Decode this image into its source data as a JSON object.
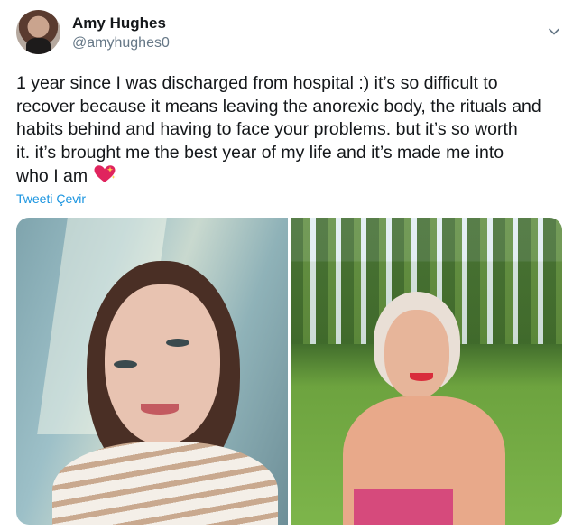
{
  "user": {
    "name": "Amy Hughes",
    "handle": "@amyhughes0"
  },
  "tweet": {
    "text": "1 year since I was discharged from hospital :) it’s so difficult to\nrecover because it means leaving the anorexic body, the rituals and\nhabits behind and having to face your problems. but it’s so worth\nit. it’s brought me the best year of my life and it’s made me into\nwho I am ",
    "emoji": "sparkling-heart-icon"
  },
  "translate_label": "Tweeti Çevir",
  "media": {
    "count": 2
  },
  "colors": {
    "text": "#14171a",
    "secondary": "#657786",
    "link": "#1b95e0",
    "heart": "#e0245e"
  }
}
